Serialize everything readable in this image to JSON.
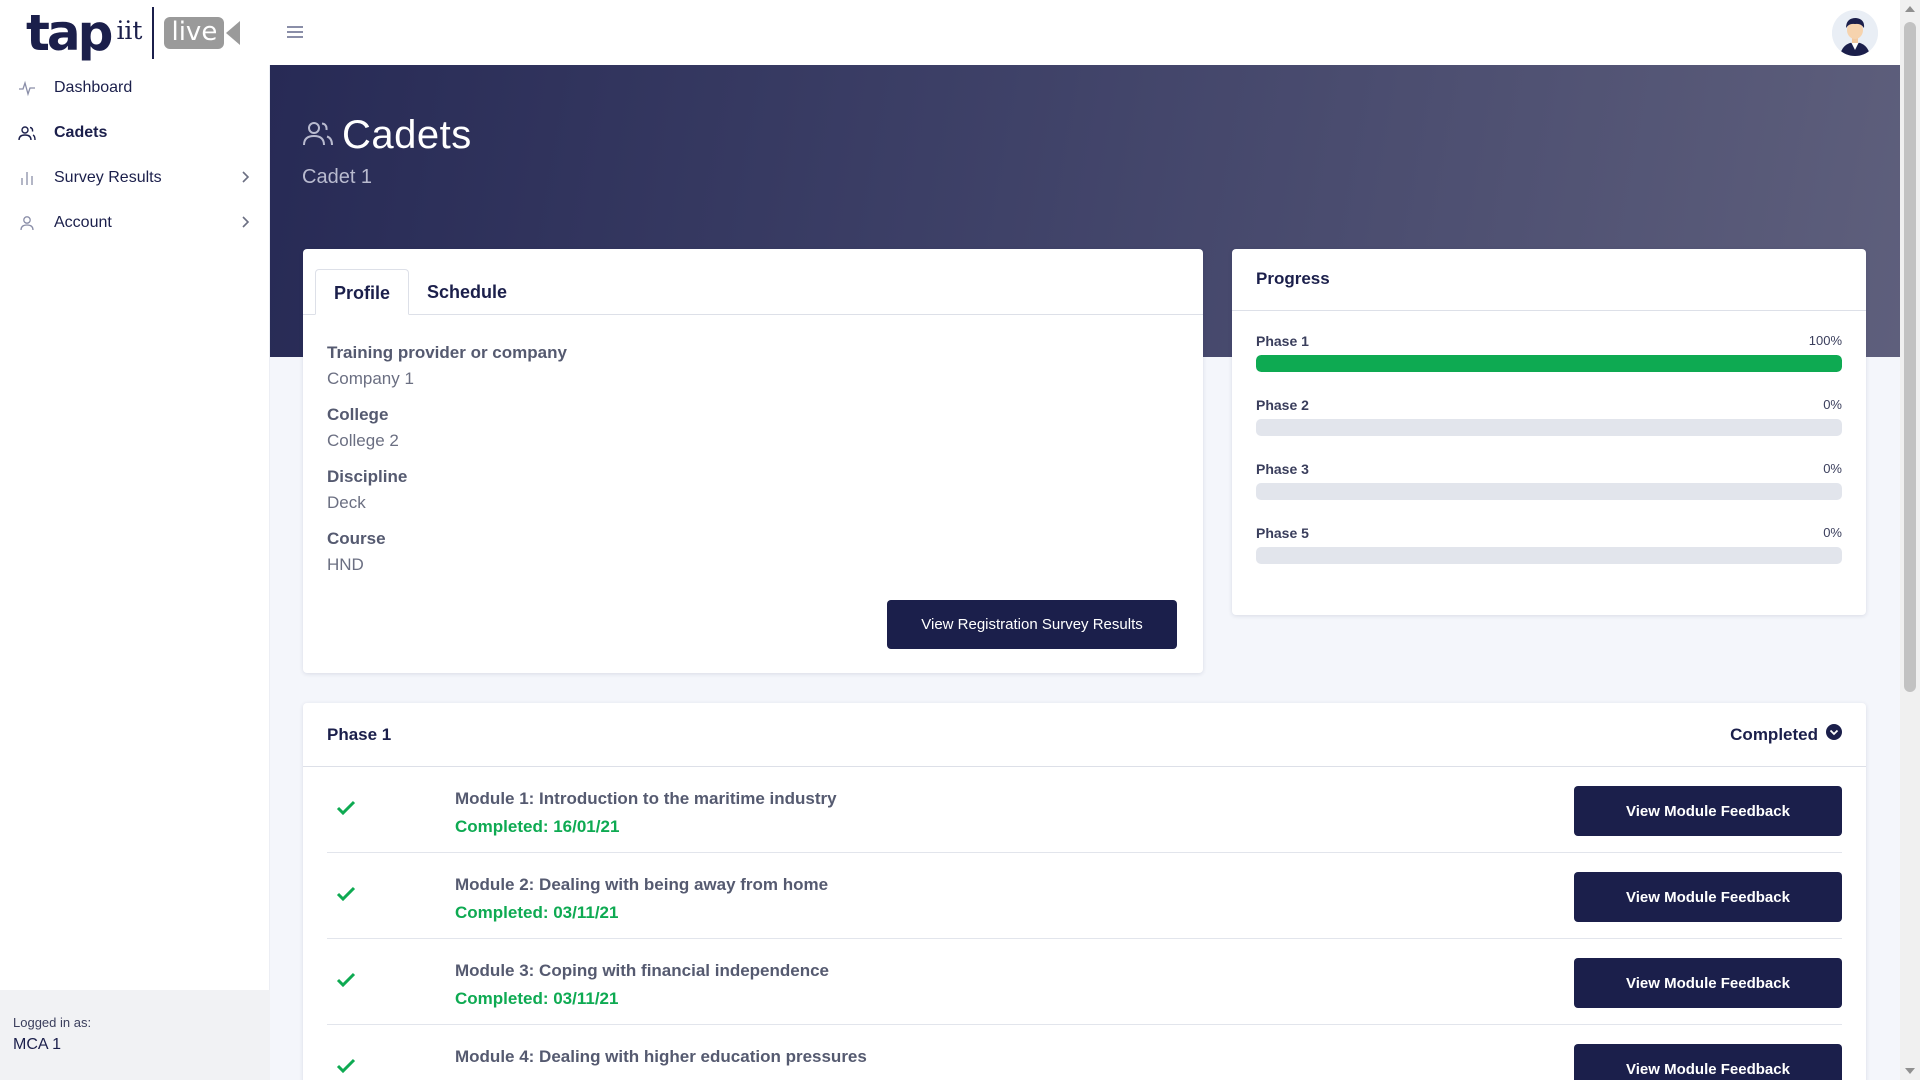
{
  "brand": {
    "logo_main": "tap",
    "logo_suffix": "iit",
    "logo_badge": "live"
  },
  "sidebar": {
    "items": [
      {
        "label": "Dashboard",
        "icon": "activity-icon"
      },
      {
        "label": "Cadets",
        "icon": "users-icon",
        "active": true
      },
      {
        "label": "Survey Results",
        "icon": "bar-chart-icon",
        "has_children": true
      },
      {
        "label": "Account",
        "icon": "user-icon",
        "has_children": true
      }
    ],
    "logged_in_label": "Logged in as:",
    "logged_in_user": "MCA 1"
  },
  "header": {
    "title": "Cadets",
    "subtitle": "Cadet 1"
  },
  "profile": {
    "tabs": [
      "Profile",
      "Schedule"
    ],
    "active_tab": "Profile",
    "fields": [
      {
        "label": "Training provider or company",
        "value": "Company 1"
      },
      {
        "label": "College",
        "value": "College 2"
      },
      {
        "label": "Discipline",
        "value": "Deck"
      },
      {
        "label": "Course",
        "value": "HND"
      }
    ],
    "survey_button": "View Registration Survey Results"
  },
  "progress": {
    "title": "Progress",
    "phases": [
      {
        "label": "Phase 1",
        "value_text": "100%",
        "value": 100
      },
      {
        "label": "Phase 2",
        "value_text": "0%",
        "value": 0
      },
      {
        "label": "Phase 3",
        "value_text": "0%",
        "value": 0
      },
      {
        "label": "Phase 5",
        "value_text": "0%",
        "value": 0
      }
    ]
  },
  "phase_panel": {
    "title": "Phase 1",
    "status": "Completed",
    "modules": [
      {
        "title": "Module 1: Introduction to the maritime industry",
        "date": "Completed: 16/01/21",
        "button": "View Module Feedback"
      },
      {
        "title": "Module 2: Dealing with being away from home",
        "date": "Completed: 03/11/21",
        "button": "View Module Feedback"
      },
      {
        "title": "Module 3: Coping with financial independence",
        "date": "Completed: 03/11/21",
        "button": "View Module Feedback"
      },
      {
        "title": "Module 4: Dealing with higher education pressures",
        "date": "",
        "button": "View Module Feedback"
      }
    ]
  },
  "colors": {
    "navy": "#1b1f4b",
    "success": "#0eaa52",
    "track": "#e2e5ec"
  }
}
